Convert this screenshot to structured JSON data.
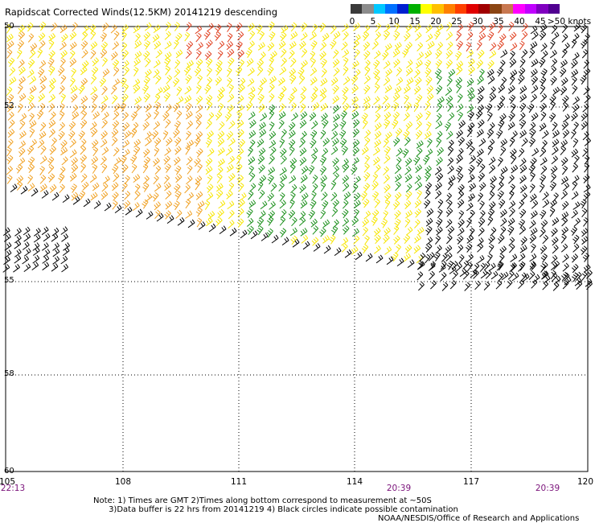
{
  "title": "Rapidscat Corrected Winds(12.5KM) 20141219 descending",
  "legend": {
    "colors": [
      "#3a3a3a",
      "#8c8c8c",
      "#00c8ff",
      "#0070ff",
      "#0020d0",
      "#00b000",
      "#ffff00",
      "#ffc000",
      "#ff8000",
      "#ff4000",
      "#e00000",
      "#a00000",
      "#8b4513",
      "#c87850",
      "#ff00ff",
      "#c000ff",
      "#8000c0",
      "#500090"
    ],
    "labels": [
      "0",
      "5",
      "10",
      "15",
      "20",
      "25",
      "30",
      "35",
      "40",
      "45",
      ">50 knots"
    ]
  },
  "lat_labels": [
    "50",
    "52",
    "55",
    "58",
    "60"
  ],
  "lon_labels": [
    "105",
    "108",
    "111",
    "114",
    "117",
    "120"
  ],
  "times": [
    "22:13",
    "20:39",
    "20:39"
  ],
  "notes": [
    "Note: 1) Times are GMT 2)Times along bottom correspond to measurement at ~50S",
    "      3)Data buffer is 22 hrs from 20141219 4) Black circles indicate possible contamination"
  ],
  "credit": "NOAA/NESDIS/Office of Research and Applications",
  "wind_colors": {
    "green": "#1a8f1a",
    "yellow": "#f7e600",
    "orange": "#f0a020",
    "red": "#e04020",
    "black": "#000000"
  }
}
